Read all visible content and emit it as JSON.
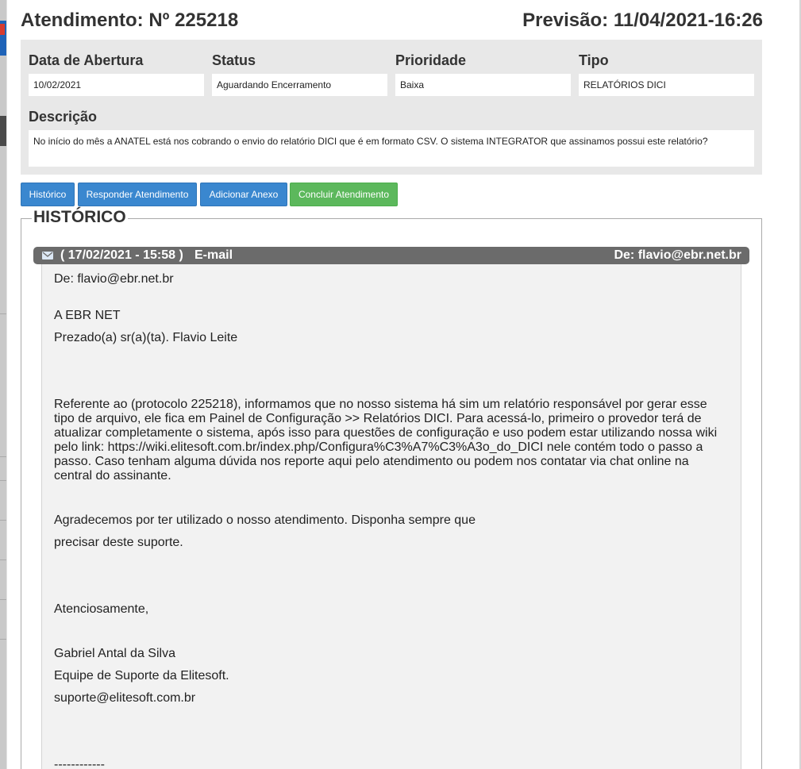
{
  "header": {
    "title": "Atendimento: Nº 225218",
    "forecast": "Previsão: 11/04/2021-16:26"
  },
  "fields": {
    "opening_date": {
      "label": "Data de Abertura",
      "value": "10/02/2021"
    },
    "status": {
      "label": "Status",
      "value": "Aguardando Encerramento"
    },
    "priority": {
      "label": "Prioridade",
      "value": "Baixa"
    },
    "type": {
      "label": "Tipo",
      "value": "RELATÓRIOS DICI"
    },
    "description": {
      "label": "Descrição",
      "value": "No início do mês a ANATEL está nos cobrando o envio do relatório DICI que é em formato CSV. O sistema INTEGRATOR que assinamos possui este relatório?"
    }
  },
  "buttons": {
    "history": "Histórico",
    "reply": "Responder Atendimento",
    "attach": "Adicionar Anexo",
    "conclude": "Concluir Atendimento"
  },
  "colors": {
    "primary_button": "#3a87cf",
    "success_button": "#5cb85c",
    "entry_bar": "#6b6b6b",
    "panel_bg": "#e8e8e8"
  },
  "history": {
    "legend": "HISTÓRICO",
    "entry": {
      "icon": "envelope-icon",
      "date": "( 17/02/2021 - 15:58 )",
      "type": "E-mail",
      "from": "De: flavio@ebr.net.br",
      "body": {
        "from_line": "De: flavio@ebr.net.br",
        "to_company": "A EBR NET",
        "greeting": "Prezado(a) sr(a)(ta). Flavio Leite",
        "paragraph": "Referente ao (protocolo 225218), informamos que no nosso sistema há sim um relatório responsável por gerar esse tipo de arquivo, ele fica em Painel de Configuração >> Relatórios DICI. Para acessá-lo, primeiro o provedor terá de atualizar completamente o sistema, após isso para questões de configuração e uso podem estar utilizando nossa wiki pelo link: https://wiki.elitesoft.com.br/index.php/Configura%C3%A7%C3%A3o_do_DICI nele contém todo o passo a passo. Caso tenham alguma dúvida nos reporte aqui pelo atendimento ou podem nos contatar via chat online na central do assinante.",
        "thanks_1": "Agradecemos por ter utilizado o nosso atendimento. Disponha sempre que",
        "thanks_2": "precisar deste suporte.",
        "closing": "Atenciosamente,",
        "signature_name": "Gabriel Antal da Silva",
        "signature_team": "Equipe de Suporte da Elitesoft.",
        "signature_email": "suporte@elitesoft.com.br",
        "separator": "------------"
      }
    }
  }
}
